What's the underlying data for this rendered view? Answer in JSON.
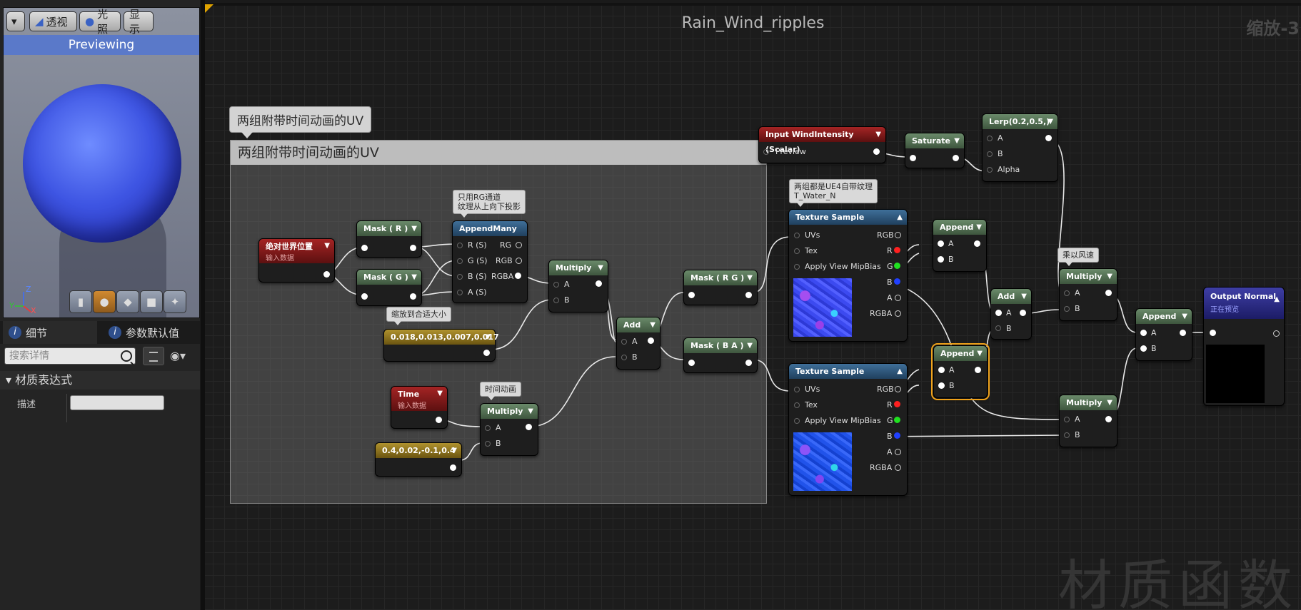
{
  "viewport": {
    "dropdown_label": "▾",
    "btn_perspective": "透视",
    "btn_lit": "光照",
    "btn_show": "显示",
    "previewing": "Previewing",
    "axis_z": "Z",
    "axis_x": "X",
    "axis_y": "Y"
  },
  "details": {
    "tab_details": "细节",
    "tab_params": "参数默认值",
    "search_placeholder": "搜索详情",
    "section_title": "材质表达式",
    "desc_label": "描述",
    "desc_value": ""
  },
  "graph": {
    "title": "Rain_Wind_ripples",
    "zoom": "缩放-3",
    "watermark": "材质函数",
    "comment_bubble": "两组附带时间动画的UV",
    "comment_header": "两组附带时间动画的UV"
  },
  "nodes": {
    "worldpos": {
      "title": "绝对世界位置",
      "sub": "输入数据"
    },
    "mask_r": {
      "title": "Mask ( R )"
    },
    "mask_g": {
      "title": "Mask ( G )"
    },
    "appendmany": {
      "title": "AppendMany",
      "tip_line1": "只用RG通道",
      "tip_line2": "纹理从上向下投影",
      "in": [
        "R (S)",
        "G (S)",
        "B (S)",
        "A (S)"
      ],
      "out": [
        "RG",
        "RGB",
        "RGBA"
      ]
    },
    "multiply1": {
      "title": "Multiply",
      "a": "A",
      "b": "B"
    },
    "scale_const": {
      "title": "0.018,0.013,0.007,0.017",
      "tip": "缩放到合适大小"
    },
    "time": {
      "title": "Time",
      "sub": "输入数据"
    },
    "multiply_time": {
      "title": "Multiply",
      "tip": "时间动画",
      "a": "A",
      "b": "B"
    },
    "time_const": {
      "title": "0.4,0.02,-0.1,0.4"
    },
    "add1": {
      "title": "Add",
      "a": "A",
      "b": "B"
    },
    "mask_rg": {
      "title": "Mask ( R G )"
    },
    "mask_ba": {
      "title": "Mask ( B A )"
    },
    "tex1": {
      "title": "Texture Sample",
      "tip_line1": "两组都是UE4自带纹理",
      "tip_line2": "T_Water_N",
      "in": [
        "UVs",
        "Tex",
        "Apply View MipBias"
      ],
      "out": [
        "RGB",
        "R",
        "G",
        "B",
        "A",
        "RGBA"
      ]
    },
    "tex2": {
      "title": "Texture Sample",
      "in": [
        "UVs",
        "Tex",
        "Apply View MipBias"
      ],
      "out": [
        "RGB",
        "R",
        "G",
        "B",
        "A",
        "RGBA"
      ]
    },
    "wind": {
      "title": "Input WindIntensity (Scalar)",
      "preview": "Preview"
    },
    "saturate": {
      "title": "Saturate"
    },
    "lerp": {
      "title": "Lerp(0.2,0.5,)",
      "a": "A",
      "b": "B",
      "alpha": "Alpha"
    },
    "append1": {
      "title": "Append",
      "a": "A",
      "b": "B"
    },
    "append2": {
      "title": "Append",
      "a": "A",
      "b": "B"
    },
    "add2": {
      "title": "Add",
      "a": "A",
      "b": "B"
    },
    "multiply_wind": {
      "title": "Multiply",
      "tip": "乘以风速",
      "a": "A",
      "b": "B"
    },
    "multiply3": {
      "title": "Multiply",
      "a": "A",
      "b": "B"
    },
    "append3": {
      "title": "Append",
      "a": "A",
      "b": "B"
    },
    "output": {
      "title": "Output Normal",
      "sub": "正在预览"
    }
  },
  "colors": {
    "accent_selected": "#f0a21a",
    "pin_r": "#ff2020",
    "pin_g": "#20e020",
    "pin_b": "#2040ff"
  }
}
